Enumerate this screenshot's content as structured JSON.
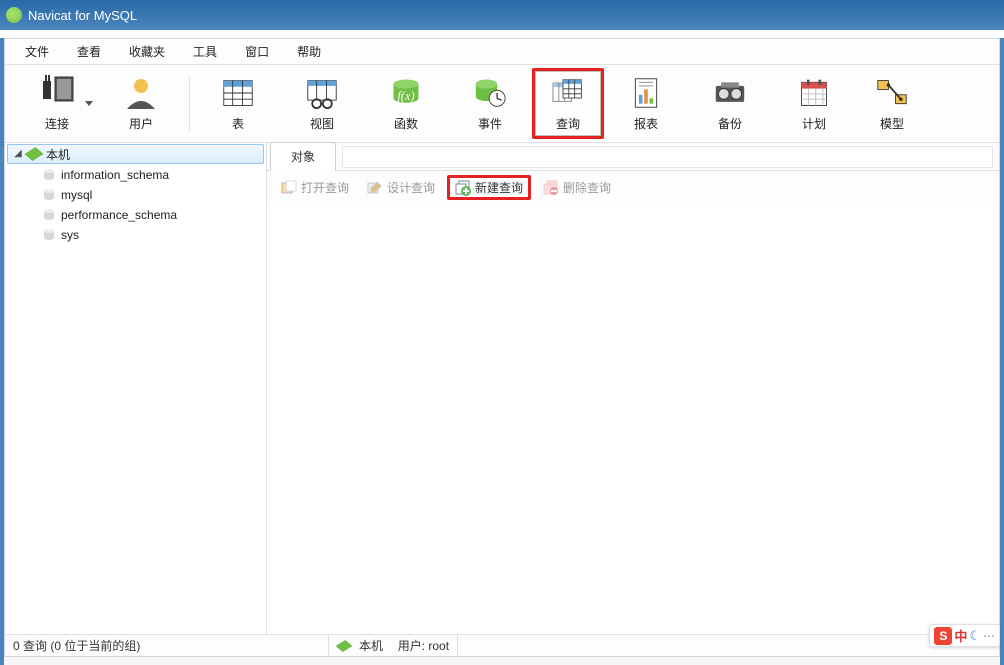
{
  "titlebar": {
    "title": "Navicat for MySQL"
  },
  "menu": {
    "file": "文件",
    "view": "查看",
    "favorites": "收藏夹",
    "tools": "工具",
    "window": "窗口",
    "help": "帮助"
  },
  "toolbar": {
    "connect": "连接",
    "user": "用户",
    "table": "表",
    "view_btn": "视图",
    "function": "函数",
    "event": "事件",
    "query": "查询",
    "report": "报表",
    "backup": "备份",
    "schedule": "计划",
    "model": "模型"
  },
  "tree": {
    "connection": "本机",
    "dbs": [
      "information_schema",
      "mysql",
      "performance_schema",
      "sys"
    ]
  },
  "content": {
    "tab_object": "对象",
    "actions": {
      "open": "打开查询",
      "design": "设计查询",
      "new": "新建查询",
      "delete": "删除查询"
    }
  },
  "status": {
    "left": "0 查询 (0 位于当前的组)",
    "conn": "本机",
    "user_label": "用户: root"
  },
  "ime": {
    "brand": "S",
    "lang": "中",
    "moon": "☾"
  }
}
